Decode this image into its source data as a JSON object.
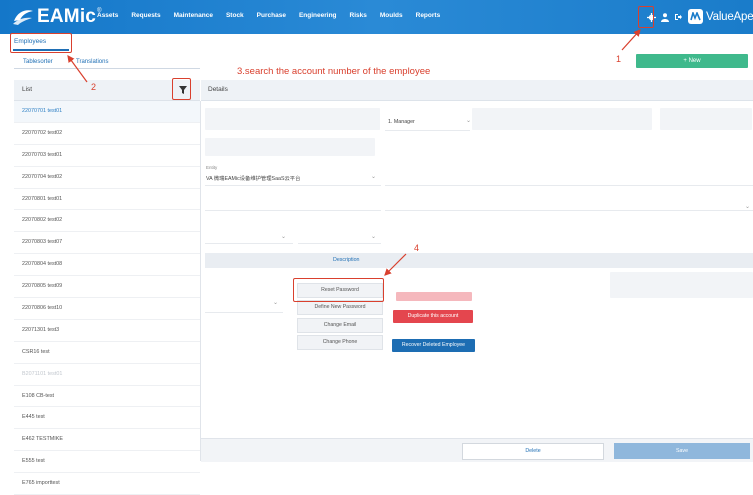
{
  "app": {
    "logo_text": "EAMic",
    "logo_sup": "®",
    "brand_text": "ValueApex",
    "nav": [
      "Assets",
      "Requests",
      "Maintenance",
      "Stock",
      "Purchase",
      "Engineering",
      "Risks",
      "Moulds",
      "Reports"
    ],
    "icons": [
      "gear-icon",
      "user-icon",
      "logout-icon",
      "brand-logo-icon"
    ]
  },
  "tabs": {
    "main": "Employees",
    "subtabs": [
      "Tablesorter",
      "Translations"
    ]
  },
  "toolbar": {
    "new_label": "+ New"
  },
  "list": {
    "title": "List",
    "items": [
      {
        "label": "22070701 test01",
        "selected": true
      },
      {
        "label": "22070702 test02"
      },
      {
        "label": "22070703 test01"
      },
      {
        "label": "22070704 test02"
      },
      {
        "label": "22070801 test01"
      },
      {
        "label": "22070802 test02"
      },
      {
        "label": "22070803 test07"
      },
      {
        "label": "22070804 test08"
      },
      {
        "label": "22070805 test09"
      },
      {
        "label": "22070806 test10"
      },
      {
        "label": "22071301 test3"
      },
      {
        "label": "CSR16 test"
      },
      {
        "label": "B2071101 test01",
        "blurred": true
      },
      {
        "label": "E108 CB-test"
      },
      {
        "label": "E445 test"
      },
      {
        "label": "E462 TESTMIKE"
      },
      {
        "label": "E555 test"
      },
      {
        "label": "E765 importtest"
      }
    ]
  },
  "details": {
    "title": "Details",
    "role_value": "1. Manager",
    "entity_label": "Entity",
    "entity_value": "VA 微瑞EAMic设备维护管理SaaS云平台",
    "description_label": "Description",
    "buttons": {
      "reset_password": "Reset Password",
      "define_new_password": "Define New Password",
      "change_email": "Change Email",
      "change_phone": "Change Phone",
      "duplicate": "Duplicate this account",
      "recover": "Recover Deleted Employee"
    }
  },
  "footer": {
    "delete_label": "Delete",
    "save_label": "Save"
  },
  "annotations": {
    "step1": "1",
    "step2": "2",
    "step3": "3.search the account number of the employee",
    "step4": "4"
  },
  "colors": {
    "topbar": "#1a7cca",
    "accent": "#1f6fb5",
    "new_button": "#3fb98c",
    "danger": "#e4464e",
    "recover": "#1d6db3",
    "annotation": "#d9402e"
  }
}
